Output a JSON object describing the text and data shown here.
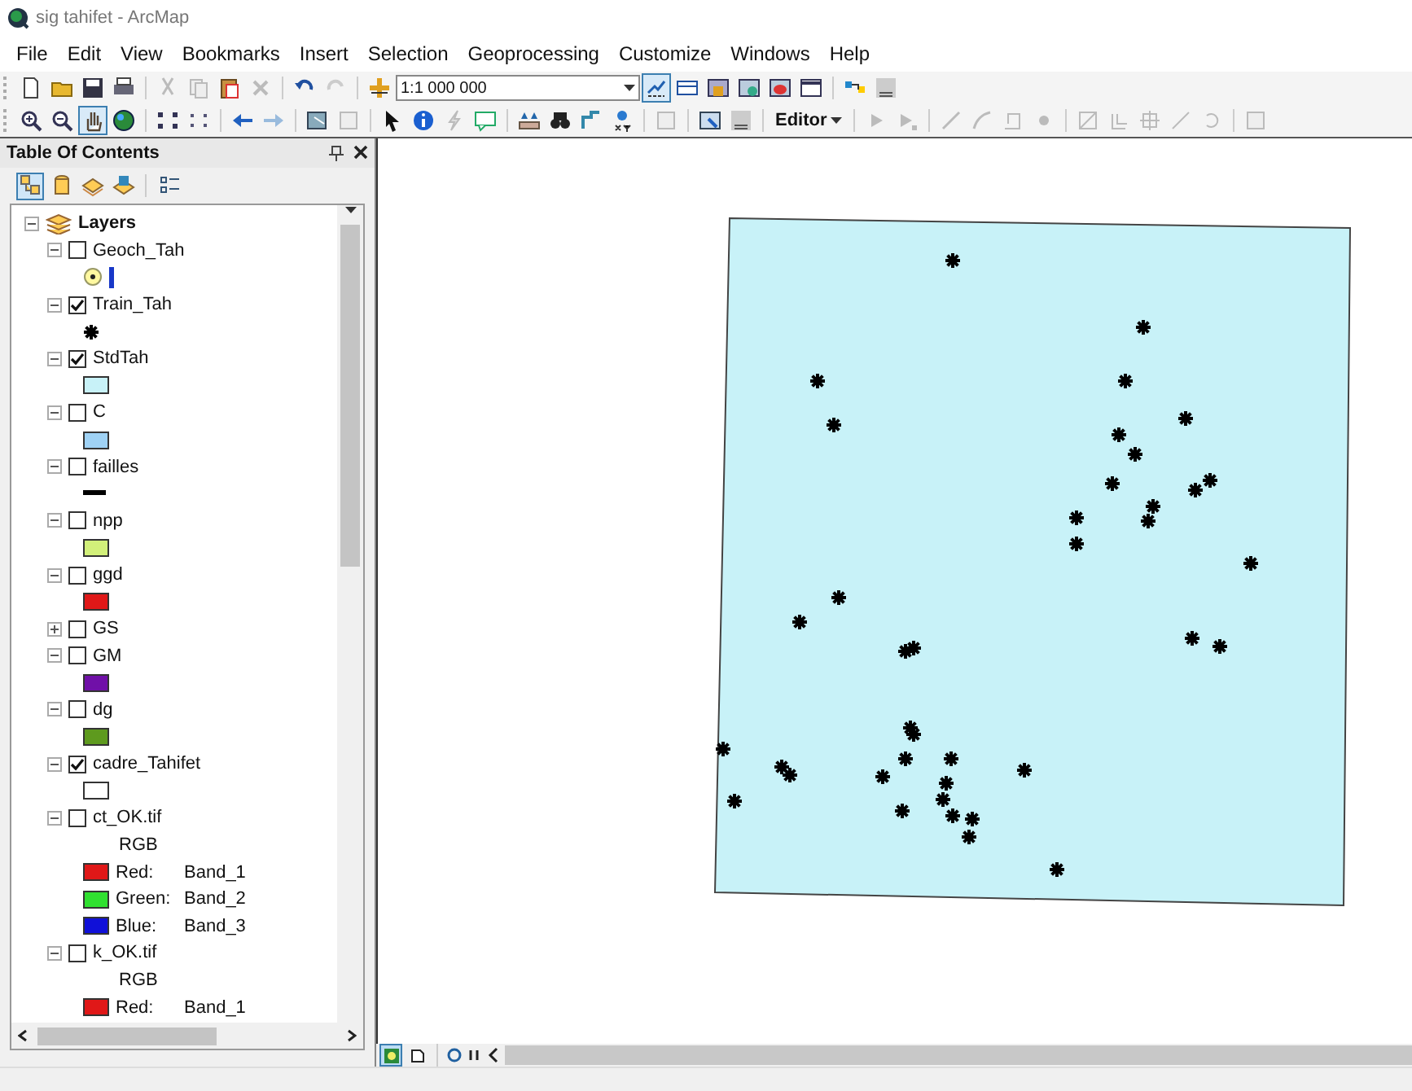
{
  "window": {
    "title": "sig tahifet - ArcMap"
  },
  "menu": [
    "File",
    "Edit",
    "View",
    "Bookmarks",
    "Insert",
    "Selection",
    "Geoprocessing",
    "Customize",
    "Windows",
    "Help"
  ],
  "standard_toolbar": {
    "scale": "1:1 000 000"
  },
  "tools_toolbar": {
    "editor": "Editor"
  },
  "toc": {
    "title": "Table Of Contents",
    "tabs": [
      {
        "kind": "drawing-order",
        "selected": true
      },
      {
        "kind": "source",
        "selected": false
      },
      {
        "kind": "visibility",
        "selected": false
      },
      {
        "kind": "selection",
        "selected": false
      },
      {
        "kind": "options",
        "selected": false
      }
    ],
    "root": {
      "label": "Layers",
      "expanded": true,
      "children": [
        {
          "name": "Geoch_Tah",
          "checked": false,
          "expanded": true,
          "legend": {
            "kind": "point"
          }
        },
        {
          "name": "Train_Tah",
          "checked": true,
          "expanded": true,
          "legend": {
            "kind": "star"
          }
        },
        {
          "name": "StdTah",
          "checked": true,
          "expanded": true,
          "legend": {
            "kind": "fill",
            "color": "#c8f2f8"
          }
        },
        {
          "name": "C",
          "checked": false,
          "expanded": true,
          "legend": {
            "kind": "fill",
            "color": "#9fd2f5"
          }
        },
        {
          "name": "failles",
          "checked": false,
          "expanded": true,
          "legend": {
            "kind": "line"
          }
        },
        {
          "name": "npp",
          "checked": false,
          "expanded": true,
          "legend": {
            "kind": "fill",
            "color": "#d2f07a"
          }
        },
        {
          "name": "ggd",
          "checked": false,
          "expanded": true,
          "legend": {
            "kind": "fill",
            "color": "#e01818"
          }
        },
        {
          "name": "GS",
          "checked": false,
          "expanded": false
        },
        {
          "name": "GM",
          "checked": false,
          "expanded": true,
          "legend": {
            "kind": "fill",
            "color": "#7010a8"
          }
        },
        {
          "name": "dg",
          "checked": false,
          "expanded": true,
          "legend": {
            "kind": "fill",
            "color": "#5e9a1e"
          }
        },
        {
          "name": "cadre_Tahifet",
          "checked": true,
          "expanded": true,
          "legend": {
            "kind": "fill",
            "color": "#ffffff"
          }
        },
        {
          "name": "ct_OK.tif",
          "checked": false,
          "expanded": true,
          "legend": {
            "kind": "rgb",
            "label": "RGB",
            "bands": [
              {
                "name": "Red:",
                "band": "Band_1",
                "color": "#e01818"
              },
              {
                "name": "Green:",
                "band": "Band_2",
                "color": "#30e030"
              },
              {
                "name": "Blue:",
                "band": "Band_3",
                "color": "#1010d8"
              }
            ]
          }
        },
        {
          "name": "k_OK.tif",
          "checked": false,
          "expanded": true,
          "legend": {
            "kind": "rgb",
            "label": "RGB",
            "bands": [
              {
                "name": "Red:",
                "band": "Band_1",
                "color": "#e01818"
              }
            ]
          }
        }
      ]
    }
  },
  "map_view_buttons": [
    {
      "kind": "data",
      "selected": true
    },
    {
      "kind": "layout",
      "selected": false
    }
  ]
}
